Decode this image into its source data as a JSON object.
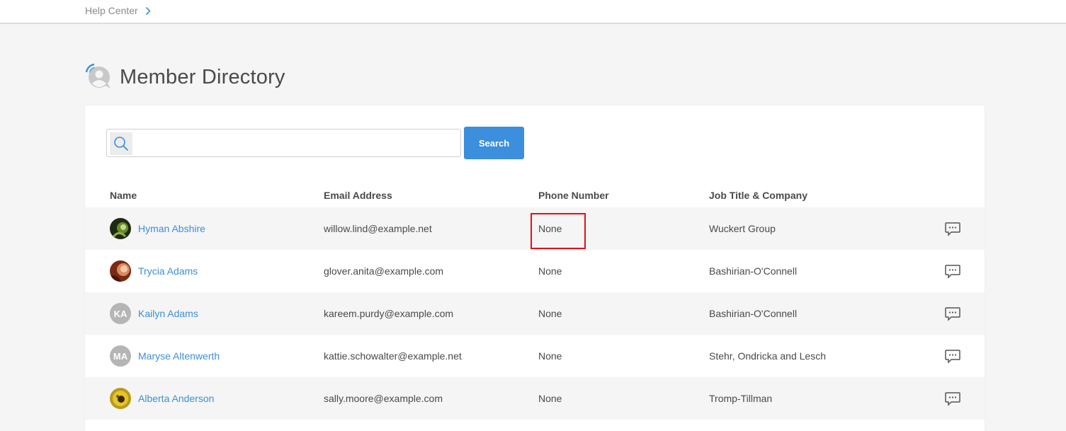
{
  "breadcrumb": {
    "label": "Help Center"
  },
  "page": {
    "title": "Member Directory"
  },
  "search": {
    "value": "",
    "placeholder": "",
    "button_label": "Search"
  },
  "table": {
    "headers": [
      "Name",
      "Email Address",
      "Phone Number",
      "Job Title & Company"
    ],
    "rows": [
      {
        "name": "Hyman Abshire",
        "email": "willow.lind@example.net",
        "phone": "None",
        "job": "Wuckert Group",
        "avatar": "photo"
      },
      {
        "name": "Trycia Adams",
        "email": "glover.anita@example.com",
        "phone": "None",
        "job": "Bashirian-O'Connell",
        "avatar": "photo"
      },
      {
        "name": "Kailyn Adams",
        "email": "kareem.purdy@example.com",
        "phone": "None",
        "job": "Bashirian-O'Connell",
        "avatar": "KA"
      },
      {
        "name": "Maryse Altenwerth",
        "email": "kattie.schowalter@example.net",
        "phone": "None",
        "job": "Stehr, Ondricka and Lesch",
        "avatar": "MA"
      },
      {
        "name": "Alberta Anderson",
        "email": "sally.moore@example.com",
        "phone": "None",
        "job": "Tromp-Tillman",
        "avatar": "photo"
      }
    ]
  },
  "colors": {
    "accent": "#3b8fdc",
    "highlight": "#e0111b"
  },
  "icons": [
    "chevron-right-icon",
    "member-directory-icon",
    "search-icon",
    "message-icon"
  ]
}
